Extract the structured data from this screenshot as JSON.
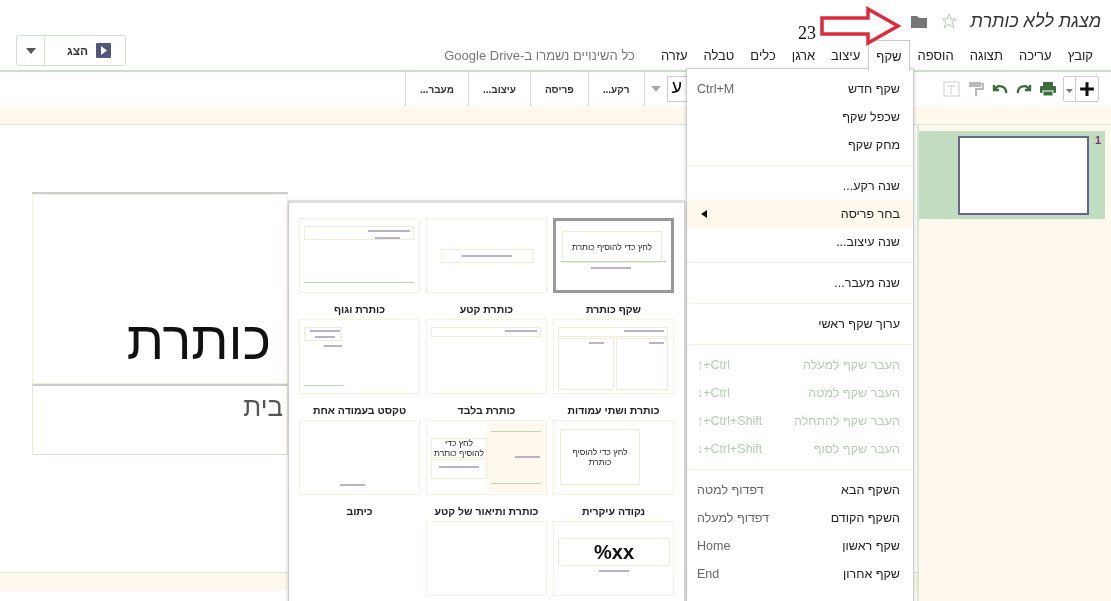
{
  "title": "מצגת ללא כותרת",
  "starred": false,
  "annotation": {
    "label": "23"
  },
  "menu_bar": {
    "items": [
      {
        "label": "קובץ",
        "selected": false
      },
      {
        "label": "עריכה",
        "selected": false
      },
      {
        "label": "תצוגה",
        "selected": false
      },
      {
        "label": "הוספה",
        "selected": false
      },
      {
        "label": "שקף",
        "selected": true
      },
      {
        "label": "עיצוב",
        "selected": false
      },
      {
        "label": "ארגן",
        "selected": false
      },
      {
        "label": "כלים",
        "selected": false
      },
      {
        "label": "טבלה",
        "selected": false
      },
      {
        "label": "עזרה",
        "selected": false
      }
    ],
    "save_status": "כל השינויים נשמרו ב-Google Drive"
  },
  "present_button": {
    "label": "הצג"
  },
  "toolbar": {
    "font_preview": "ע",
    "buttons": [
      "רקע...",
      "פריסה",
      "עיצוב...",
      "מעבר..."
    ]
  },
  "slide_menu": {
    "items": [
      {
        "kind": "item",
        "label": "שקף חדש",
        "shortcut": "Ctrl+M",
        "disabled": false,
        "highlighted": false,
        "submenu": false
      },
      {
        "kind": "item",
        "label": "שכפל שקף",
        "disabled": false,
        "highlighted": false,
        "submenu": false
      },
      {
        "kind": "item",
        "label": "מחק שקף",
        "disabled": false,
        "highlighted": false,
        "submenu": false
      },
      {
        "kind": "separator"
      },
      {
        "kind": "item",
        "label": "שנה רקע...",
        "disabled": false,
        "highlighted": false,
        "submenu": false
      },
      {
        "kind": "item",
        "label": "בחר פריסה",
        "disabled": false,
        "highlighted": true,
        "submenu": true
      },
      {
        "kind": "item",
        "label": "שנה עיצוב...",
        "disabled": false,
        "highlighted": false,
        "submenu": false
      },
      {
        "kind": "separator"
      },
      {
        "kind": "item",
        "label": "שנה מעבר...",
        "disabled": false,
        "highlighted": false,
        "submenu": false
      },
      {
        "kind": "separator"
      },
      {
        "kind": "item",
        "label": "ערוך שקף ראשי",
        "disabled": false,
        "highlighted": false,
        "submenu": false
      },
      {
        "kind": "separator"
      },
      {
        "kind": "item",
        "label": "העבר שקף למעלה",
        "shortcut": "Ctrl+↑",
        "disabled": true,
        "highlighted": false,
        "submenu": false
      },
      {
        "kind": "item",
        "label": "העבר שקף למטה",
        "shortcut": "Ctrl+↓",
        "disabled": true,
        "highlighted": false,
        "submenu": false
      },
      {
        "kind": "item",
        "label": "העבר שקף להתחלה",
        "shortcut": "Ctrl+Shift+↑",
        "disabled": true,
        "highlighted": false,
        "submenu": false
      },
      {
        "kind": "item",
        "label": "העבר שקף לסוף",
        "shortcut": "Ctrl+Shift+↓",
        "disabled": true,
        "highlighted": false,
        "submenu": false
      },
      {
        "kind": "separator"
      },
      {
        "kind": "item",
        "label": "השקף הבא",
        "shortcut": "דפדוף למטה",
        "disabled": false,
        "highlighted": false,
        "submenu": false
      },
      {
        "kind": "item",
        "label": "השקף הקודם",
        "shortcut": "דפדוף למעלה",
        "disabled": false,
        "highlighted": false,
        "submenu": false
      },
      {
        "kind": "item",
        "label": "שקף ראשון",
        "shortcut": "Home",
        "disabled": false,
        "highlighted": false,
        "submenu": false
      },
      {
        "kind": "item",
        "label": "שקף אחרון",
        "shortcut": "End",
        "disabled": false,
        "highlighted": false,
        "submenu": false
      }
    ]
  },
  "layout_menu": {
    "layouts": [
      {
        "kind": "title",
        "label": "שקף כותרת",
        "selected": true,
        "placeholder": "לחץ כדי להוסיף כותרת"
      },
      {
        "kind": "section",
        "label": "כותרת קטע",
        "selected": false
      },
      {
        "kind": "title-body",
        "label": "כותרת וגוף",
        "selected": false
      },
      {
        "kind": "two-columns",
        "label": "כותרת ושתי עמודות",
        "selected": false
      },
      {
        "kind": "title-only",
        "label": "כותרת בלבד",
        "selected": false
      },
      {
        "kind": "one-column",
        "label": "טקסט בעמודה אחת",
        "selected": false
      },
      {
        "kind": "main-point",
        "label": "נקודה עיקרית",
        "selected": false,
        "placeholder": "לחץ כדי להוסיף כותרת"
      },
      {
        "kind": "section-description",
        "label": "כותרת ותיאור של קטע",
        "selected": false,
        "placeholder": "לחץ כדי להוסיף כותרת"
      },
      {
        "kind": "caption",
        "label": "כיתוב",
        "selected": false
      },
      {
        "kind": "big-number",
        "selected": false,
        "placeholder": "xx%"
      },
      {
        "kind": "blank",
        "selected": false
      }
    ]
  },
  "filmstrip": {
    "slides": [
      {
        "number": "1",
        "selected": true
      }
    ]
  },
  "slide": {
    "title": "כותרת",
    "subtitle": "בית"
  }
}
